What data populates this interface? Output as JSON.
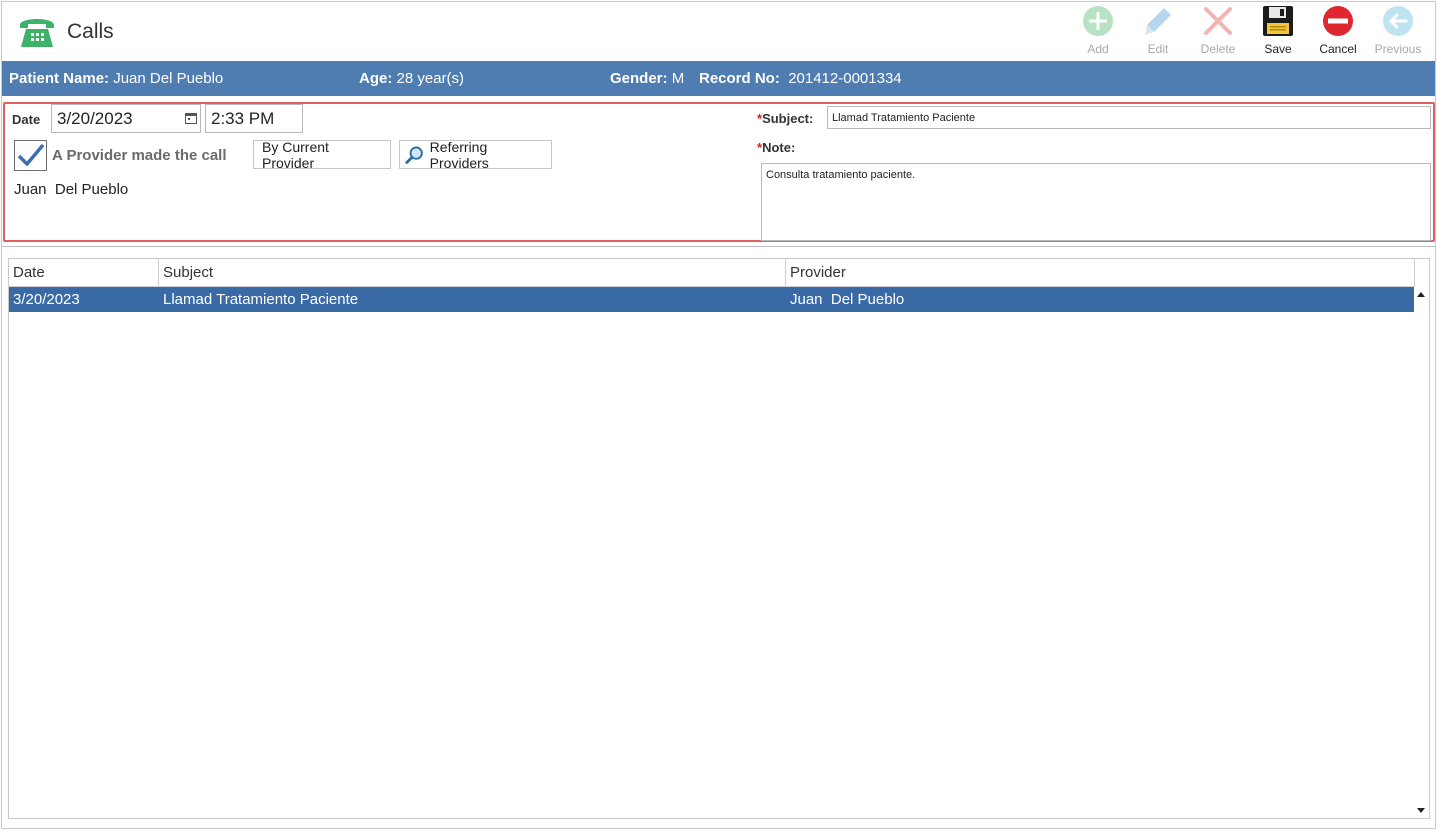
{
  "window": {
    "title": "Calls",
    "icon": "telephone-icon"
  },
  "toolbar": {
    "add_label": "Add",
    "edit_label": "Edit",
    "delete_label": "Delete",
    "save_label": "Save",
    "cancel_label": "Cancel",
    "previous_label": "Previous"
  },
  "patient": {
    "name_label": "Patient Name:",
    "name": "Juan Del Pueblo",
    "age_label": "Age:",
    "age": "28 year(s)",
    "gender_label": "Gender:",
    "gender": "M",
    "record_label": "Record No:",
    "record": "201412-0001334"
  },
  "form": {
    "date_label": "Date",
    "date_value": "3/20/2023",
    "time_value": "2:33 PM",
    "provider_checkbox_label": "A Provider made the call",
    "provider_checked": true,
    "by_current_provider_label": "By Current Provider",
    "referring_providers_label": "Referring Providers",
    "provider_name": "Juan  Del Pueblo",
    "required_marker": "*",
    "subject_label": "Subject:",
    "subject_value": "Llamad Tratamiento Paciente",
    "note_label": "Note:",
    "note_value": "Consulta tratamiento paciente."
  },
  "grid": {
    "columns": [
      "Date",
      "Subject",
      "Provider"
    ],
    "rows": [
      {
        "date": "3/20/2023",
        "subject": "Llamad Tratamiento Paciente",
        "provider": "Juan  Del Pueblo",
        "selected": true
      }
    ]
  },
  "colors": {
    "banner": "#4f7db1",
    "selected_row": "#3a6aa6",
    "highlight_border": "#e06060",
    "required": "#d42020"
  }
}
